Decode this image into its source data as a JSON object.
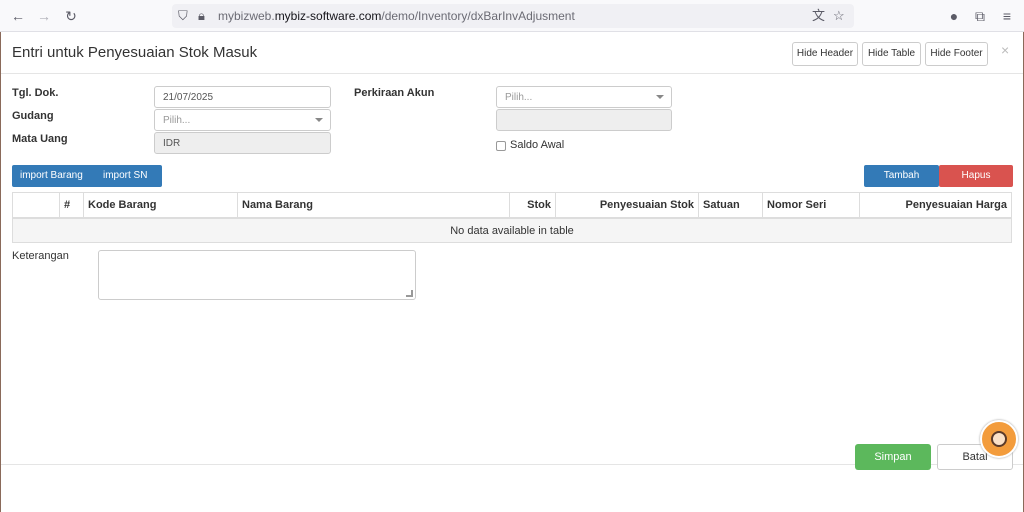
{
  "browser": {
    "url_prefix": "mybizweb.",
    "url_domain": "mybiz-software.com",
    "url_path": "/demo/Inventory/dxBarInvAdjusment"
  },
  "modal": {
    "title": "Entri untuk Penyesuaian Stok Masuk",
    "hide_header": "Hide Header",
    "hide_table": "Hide Table",
    "hide_footer": "Hide Footer",
    "close": "×"
  },
  "form": {
    "tgl_label": "Tgl. Dok.",
    "tgl_value": "21/07/2025",
    "gudang_label": "Gudang",
    "gudang_placeholder": "Pilih...",
    "mata_uang_label": "Mata Uang",
    "mata_uang_value": "IDR",
    "perkiraan_label": "Perkiraan Akun",
    "perkiraan_placeholder": "Pilih...",
    "saldo_awal_label": "Saldo Awal"
  },
  "actions": {
    "import_barang": "import Barang",
    "import_sn": "import SN",
    "tambah": "Tambah",
    "hapus": "Hapus"
  },
  "table": {
    "columns": [
      "",
      "#",
      "Kode Barang",
      "Nama Barang",
      "Stok",
      "Penyesuaian Stok",
      "Satuan",
      "Nomor Seri",
      "Penyesuaian Harga"
    ],
    "empty_text": "No data available in table"
  },
  "keterangan_label": "Keterangan",
  "footer": {
    "simpan": "Simpan",
    "batal": "Batal"
  }
}
